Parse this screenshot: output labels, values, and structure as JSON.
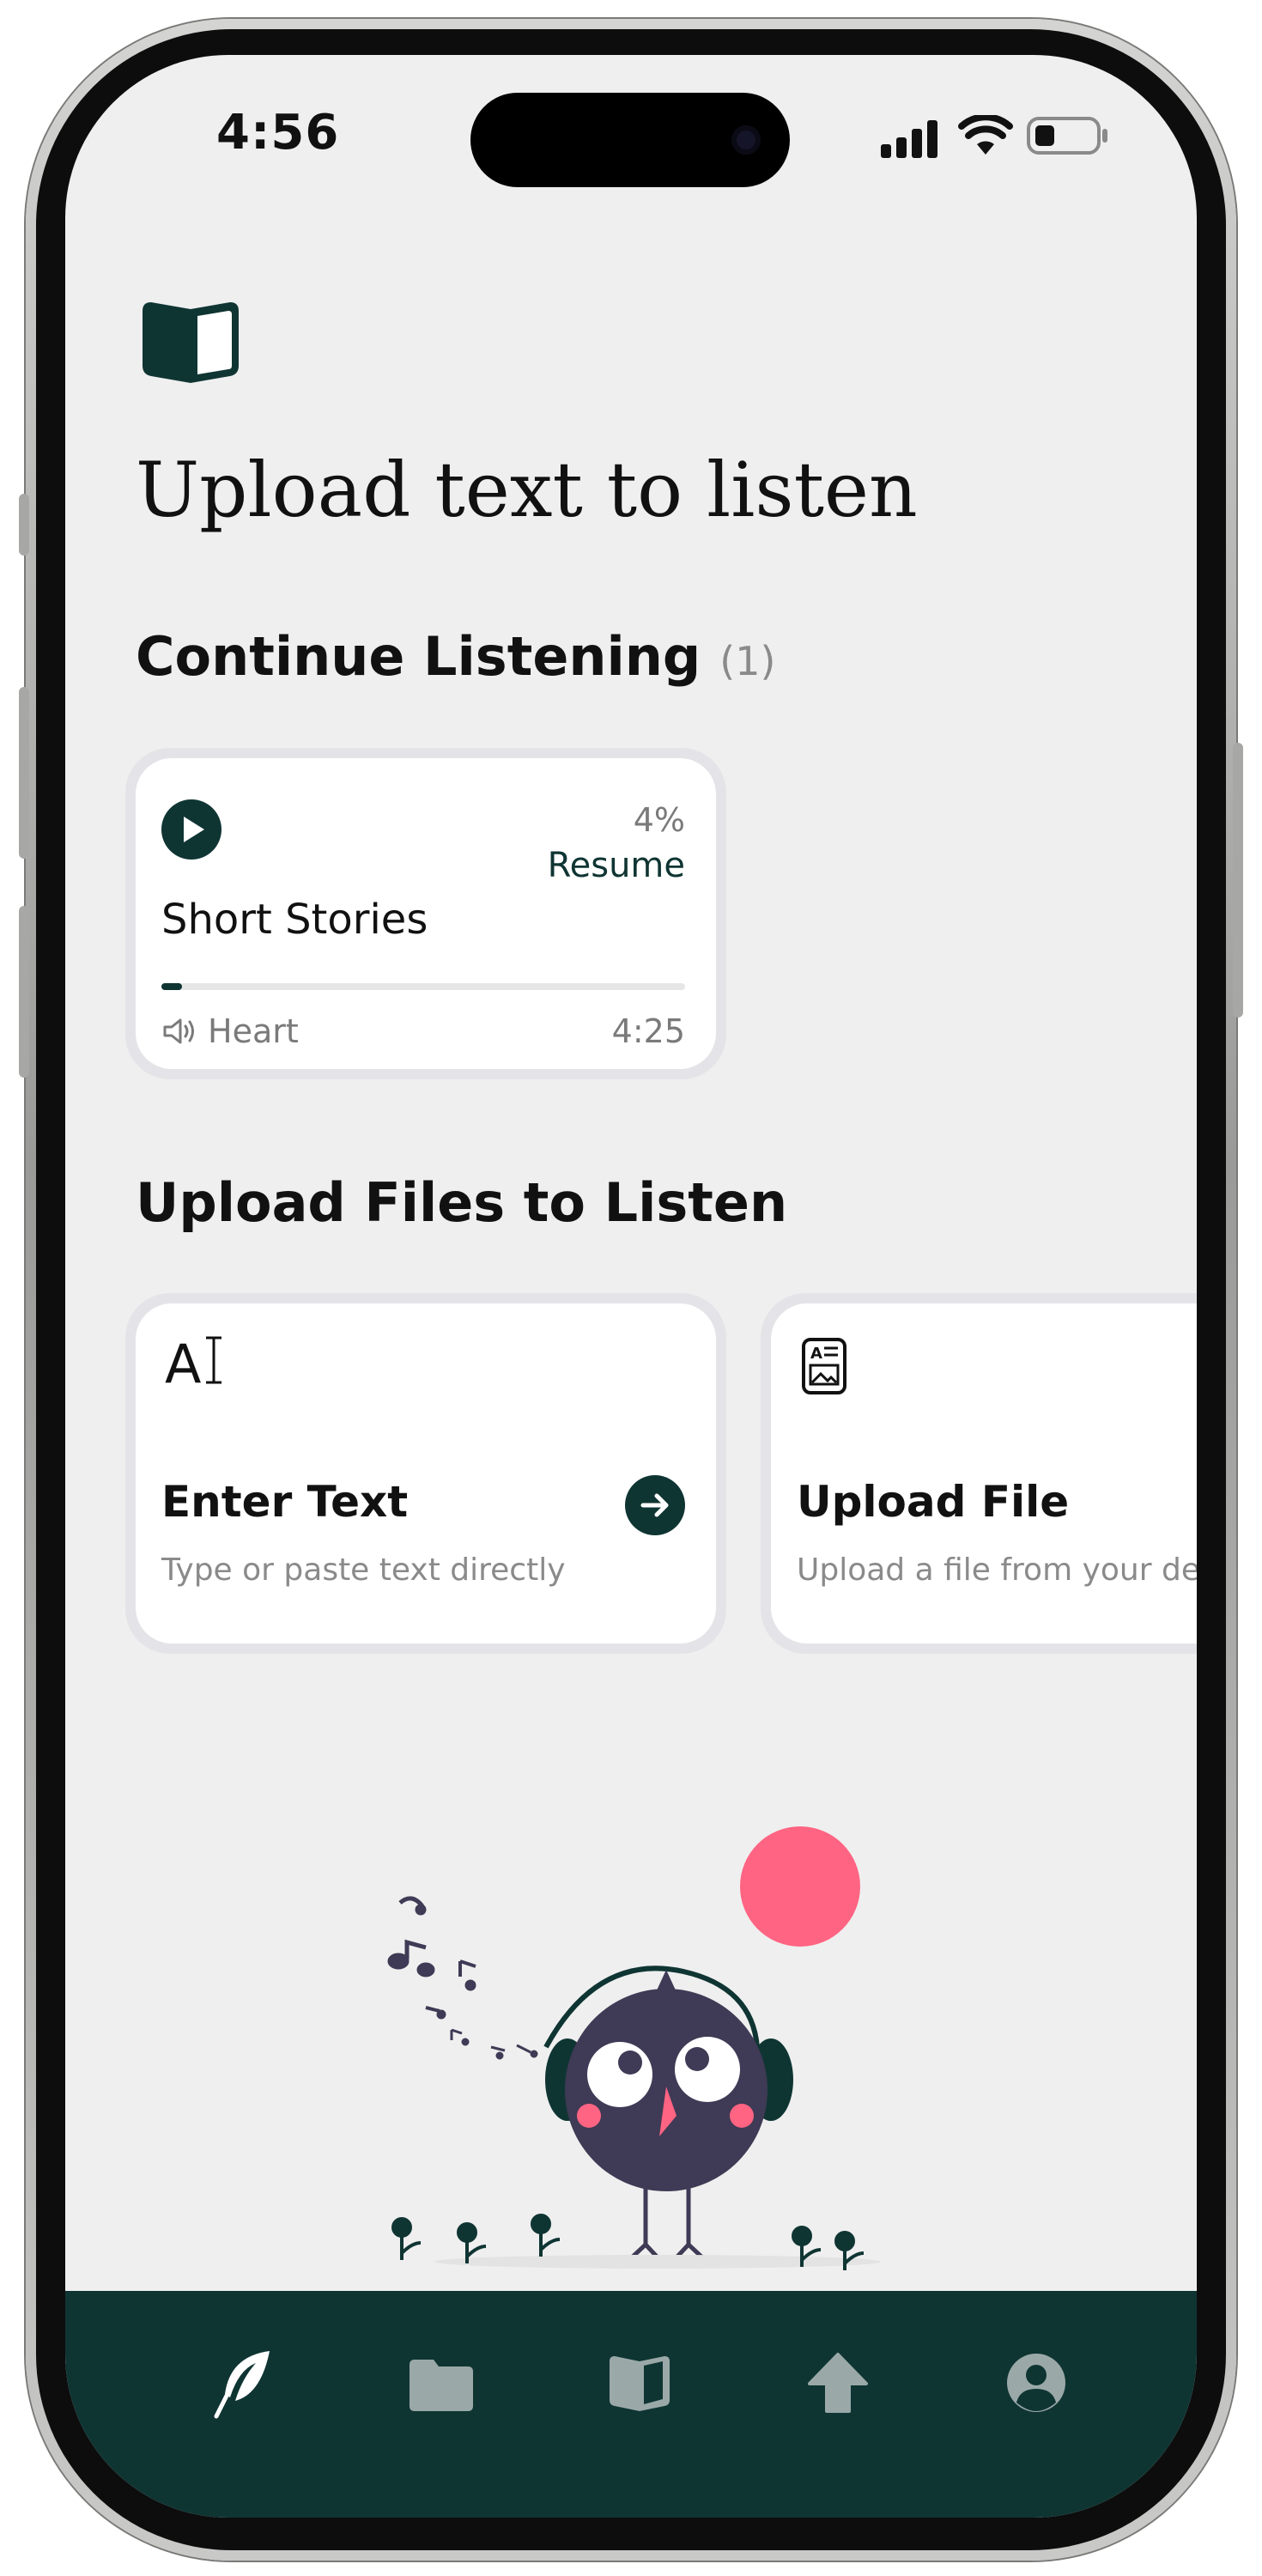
{
  "status_bar": {
    "time": "4:56"
  },
  "page": {
    "title": "Upload text to listen"
  },
  "continue_listening": {
    "title": "Continue Listening",
    "count": "(1)",
    "items": [
      {
        "title": "Short Stories",
        "percent": "4%",
        "progress": 0.04,
        "action": "Resume",
        "voice": "Heart",
        "duration": "4:25"
      }
    ]
  },
  "upload_section": {
    "title": "Upload Files to Listen",
    "options": [
      {
        "icon": "text-cursor-icon",
        "icon_text": "A",
        "title": "Enter Text",
        "subtitle": "Type or paste text directly"
      },
      {
        "icon": "document-image-icon",
        "title": "Upload File",
        "subtitle": "Upload a file from your device"
      }
    ]
  },
  "bottom_nav": {
    "items": [
      {
        "icon": "feather-icon",
        "active": true
      },
      {
        "icon": "folder-icon",
        "active": false
      },
      {
        "icon": "book-icon",
        "active": false
      },
      {
        "icon": "upload-arrow-icon",
        "active": false
      },
      {
        "icon": "profile-icon",
        "active": false
      }
    ]
  },
  "colors": {
    "accent": "#0f3533",
    "background": "#efefef",
    "muted": "#8a8a8a",
    "sun": "#ff6482",
    "bird": "#3f3a55"
  }
}
